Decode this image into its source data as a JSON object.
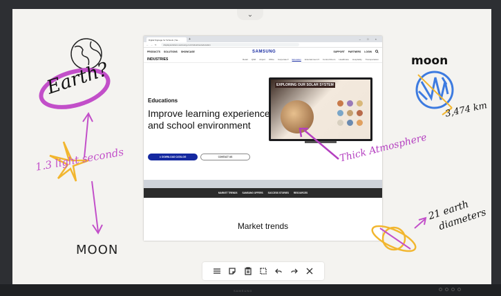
{
  "browser": {
    "tab_title": "Digital Signage for Schools | Sa...",
    "url": "displaysolutions.samsung.com/industries/education",
    "window_controls": "– □ ×",
    "nav_left": [
      "PRODUCTS",
      "SOLUTIONS",
      "SHOWCASE"
    ],
    "logo": "SAMSUNG",
    "nav_right": [
      "SUPPORT",
      "PARTNERS",
      "LOGIN"
    ],
    "industries_label": "INDUSTRIES",
    "industry_links": [
      "Retail",
      "QSR",
      "Airport",
      "Office",
      "Corporate ▾",
      "Education",
      "Entertainment ▾",
      "Control Room",
      "Healthcare",
      "Hospitality",
      "Transportation"
    ],
    "active_industry_index": 5,
    "hero": {
      "eyebrow": "Educations",
      "title": "Improve learning experience and school environment",
      "download_label": "⬇ DOWNLOAD CATALOG",
      "contact_label": "CONTACT US"
    },
    "monitor_title": "EXPLORING OUR SOLAR SYSTEM",
    "section_nav": [
      "MARKET TRENDS",
      "SAMSUNG OFFERS",
      "SUCCESS STORIES",
      "RESOURCES"
    ],
    "section_title": "Market trends"
  },
  "annotations": {
    "earth": "Earth?",
    "light_seconds": "1.3 light seconds",
    "moon_left": "MOON",
    "moon_right": "moon",
    "distance_km": "3,474 km",
    "thick_atmosphere": "Thick Atmosphere",
    "diameters_line1": "21 earth",
    "diameters_line2": "diameters"
  },
  "colors": {
    "samsung_blue": "#1428a0",
    "ink_purple": "#c24fc9",
    "ink_yellow": "#f2b62f",
    "ink_blue": "#3d7be0"
  },
  "toolbar": {
    "tools": [
      "menu-icon",
      "note-icon",
      "paste-icon",
      "select-icon",
      "undo-icon",
      "redo-icon",
      "close-icon"
    ]
  },
  "bezel": {
    "brand": "SAMSUNG"
  }
}
